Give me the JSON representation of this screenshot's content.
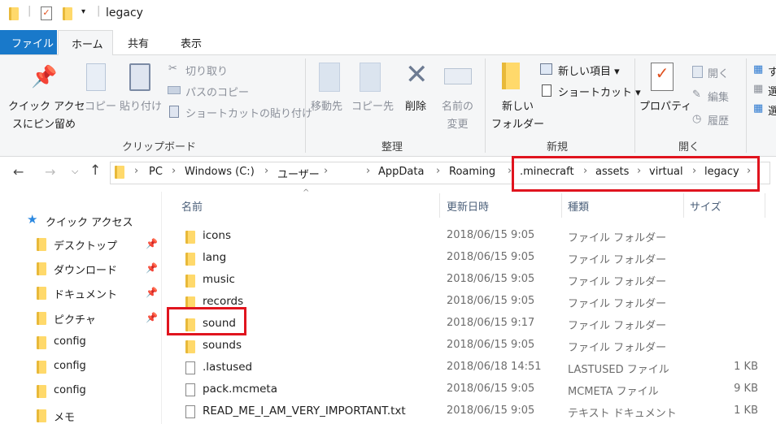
{
  "window": {
    "title": "legacy"
  },
  "tabs": [
    {
      "label": "ファイル"
    },
    {
      "label": "ホーム"
    },
    {
      "label": "共有"
    },
    {
      "label": "表示"
    }
  ],
  "ribbon": {
    "clipboard": {
      "group": "クリップボード",
      "pin_line1": "クイック アクセ",
      "pin_line2": "スにピン留め",
      "copy": "コピー",
      "paste": "貼り付け",
      "cut": "切り取り",
      "copy_path": "パスのコピー",
      "paste_shortcut": "ショートカットの貼り付け"
    },
    "organize": {
      "group": "整理",
      "move_to": "移動先",
      "copy_to": "コピー先",
      "delete": "削除",
      "rename_line1": "名前の",
      "rename_line2": "変更"
    },
    "new": {
      "group": "新規",
      "new_folder_line1": "新しい",
      "new_folder_line2": "フォルダー",
      "new_item": "新しい項目",
      "shortcut": "ショートカット"
    },
    "open": {
      "group": "開く",
      "properties": "プロパティ",
      "open": "開く",
      "edit": "編集",
      "history": "履歴"
    },
    "select": {
      "items": [
        "す",
        "選",
        "選"
      ]
    }
  },
  "address": {
    "crumbs": [
      "PC",
      "Windows (C:)",
      "ユーザー",
      "",
      "AppData",
      "Roaming",
      ".minecraft",
      "assets",
      "virtual",
      "legacy"
    ]
  },
  "nav": {
    "quick_access": "クイック アクセス",
    "items": [
      {
        "label": "デスクトップ",
        "pinned": true
      },
      {
        "label": "ダウンロード",
        "pinned": true
      },
      {
        "label": "ドキュメント",
        "pinned": true
      },
      {
        "label": "ピクチャ",
        "pinned": true
      },
      {
        "label": "config"
      },
      {
        "label": "config"
      },
      {
        "label": "config"
      },
      {
        "label": "メモ"
      }
    ]
  },
  "columns": {
    "name": "名前",
    "modified": "更新日時",
    "type": "種類",
    "size": "サイズ"
  },
  "files": [
    {
      "name": "icons",
      "modified": "2018/06/15 9:05",
      "type": "ファイル フォルダー",
      "size": "",
      "icon": "folder"
    },
    {
      "name": "lang",
      "modified": "2018/06/15 9:05",
      "type": "ファイル フォルダー",
      "size": "",
      "icon": "folder"
    },
    {
      "name": "music",
      "modified": "2018/06/15 9:05",
      "type": "ファイル フォルダー",
      "size": "",
      "icon": "folder"
    },
    {
      "name": "records",
      "modified": "2018/06/15 9:05",
      "type": "ファイル フォルダー",
      "size": "",
      "icon": "folder"
    },
    {
      "name": "sound",
      "modified": "2018/06/15 9:17",
      "type": "ファイル フォルダー",
      "size": "",
      "icon": "folder"
    },
    {
      "name": "sounds",
      "modified": "2018/06/15 9:05",
      "type": "ファイル フォルダー",
      "size": "",
      "icon": "folder"
    },
    {
      "name": ".lastused",
      "modified": "2018/06/18 14:51",
      "type": "LASTUSED ファイル",
      "size": "1 KB",
      "icon": "file"
    },
    {
      "name": "pack.mcmeta",
      "modified": "2018/06/15 9:05",
      "type": "MCMETA ファイル",
      "size": "9 KB",
      "icon": "file"
    },
    {
      "name": "READ_ME_I_AM_VERY_IMPORTANT.txt",
      "modified": "2018/06/15 9:05",
      "type": "テキスト ドキュメント",
      "size": "1 KB",
      "icon": "text-file"
    }
  ],
  "colors": {
    "file_tab": "#1979ca",
    "highlight": "#e0141e"
  }
}
